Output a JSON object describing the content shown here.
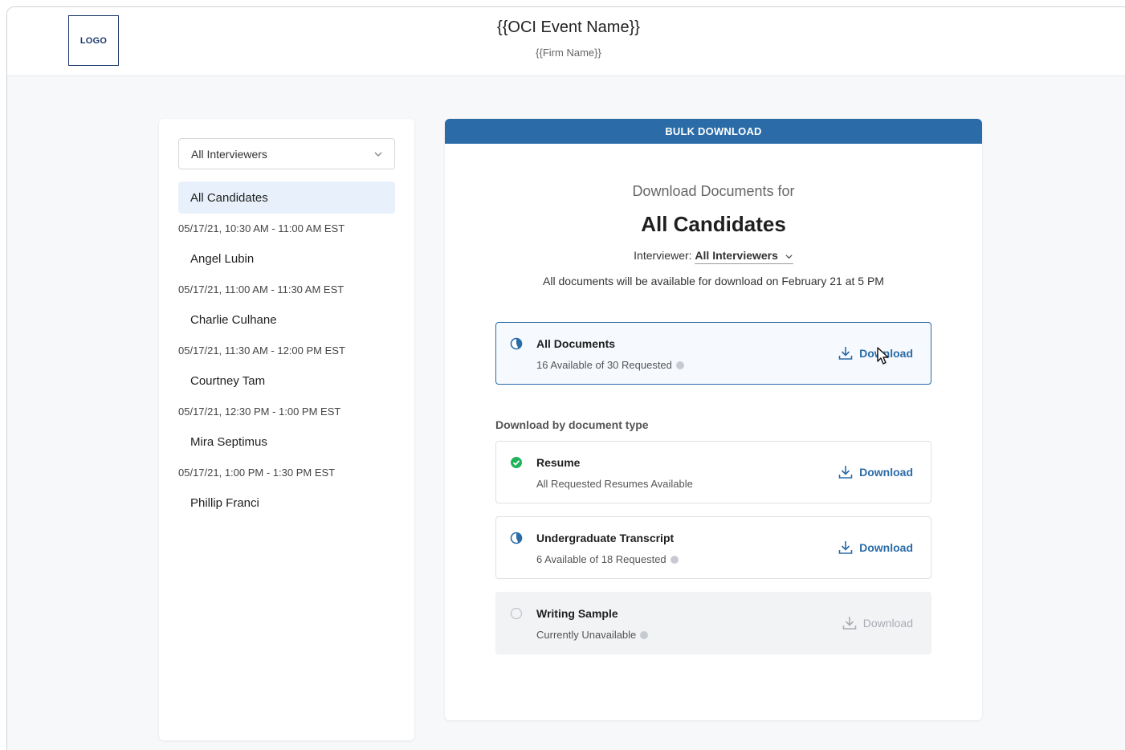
{
  "header": {
    "logo": "LOGO",
    "event_title": "{{OCI Event Name}}",
    "firm_name": "{{Firm Name}}"
  },
  "sidebar": {
    "filter": {
      "selected": "All Interviewers"
    },
    "all_candidates": "All Candidates",
    "slots": [
      {
        "time": "05/17/21, 10:30 AM - 11:00 AM EST",
        "name": "Angel Lubin"
      },
      {
        "time": "05/17/21, 11:00 AM - 11:30 AM EST",
        "name": "Charlie Culhane"
      },
      {
        "time": "05/17/21, 11:30 AM - 12:00 PM EST",
        "name": "Courtney Tam"
      },
      {
        "time": "05/17/21, 12:30 PM - 1:00 PM EST",
        "name": "Mira Septimus"
      },
      {
        "time": "05/17/21, 1:00 PM - 1:30 PM EST",
        "name": "Phillip Franci"
      }
    ]
  },
  "main": {
    "header": "BULK DOWNLOAD",
    "download_for": "Download Documents for",
    "target": "All Candidates",
    "interviewer_label": "Interviewer:",
    "interviewer_value": "All Interviewers",
    "availability_note": "All documents will be available for download on February 21 at 5 PM",
    "section_label": "Download by document type",
    "download_label": "Download",
    "documents": [
      {
        "title": "All Documents",
        "subtitle": "16 Available of 30 Requested",
        "status": "partial",
        "info": true
      },
      {
        "title": "Resume",
        "subtitle": "All Requested Resumes Available",
        "status": "complete",
        "info": false
      },
      {
        "title": "Undergraduate Transcript",
        "subtitle": "6 Available of 18 Requested",
        "status": "partial",
        "info": true
      },
      {
        "title": "Writing Sample",
        "subtitle": "Currently Unavailable",
        "status": "unavailable",
        "info": true
      }
    ]
  },
  "colors": {
    "accent": "#2a6ba8",
    "success": "#1fb45a",
    "selected_bg": "#e8f1fb",
    "disabled": "#a9adb3"
  }
}
